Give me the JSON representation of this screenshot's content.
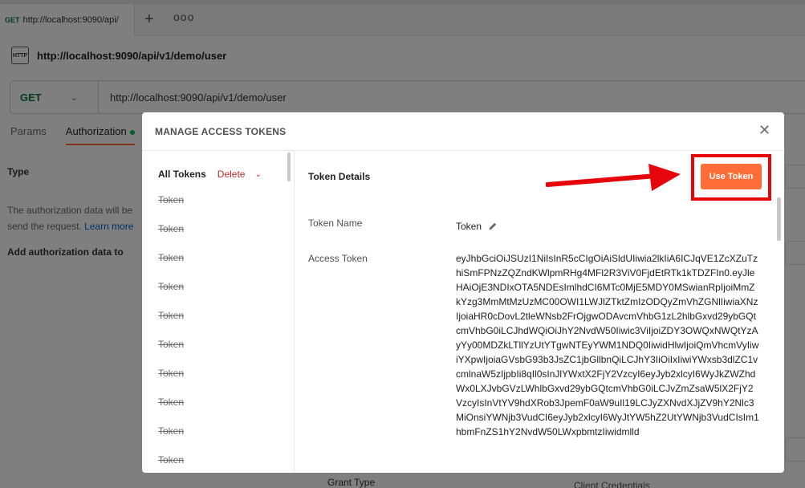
{
  "app": {
    "tab": {
      "method": "GET",
      "url": "http://localhost:9090/api/"
    },
    "request_title": "http://localhost:9090/api/v1/demo/user",
    "http_icon_text": "HTTP",
    "method": "GET",
    "url": "http://localhost:9090/api/v1/demo/user",
    "subtabs": {
      "params": "Params",
      "authorization": "Authorization"
    },
    "auth_panel": {
      "type_label": "Type",
      "description": "The authorization data will be",
      "description2": "send the request.",
      "learn_more": "Learn more",
      "add_to_label": "Add authorization data to"
    },
    "grant_type_label": "Grant Type",
    "grant_type_value": "Client Credentials"
  },
  "modal": {
    "title": "MANAGE ACCESS TOKENS",
    "sidebar": {
      "all_tokens": "All Tokens",
      "delete": "Delete",
      "tokens": [
        "Token",
        "Token",
        "Token",
        "Token",
        "Token",
        "Token",
        "Token",
        "Token",
        "Token",
        "Token"
      ]
    },
    "details": {
      "title": "Token Details",
      "use_token_label": "Use Token",
      "token_name_label": "Token Name",
      "token_name_value": "Token",
      "access_token_label": "Access Token",
      "access_token_value": "eyJhbGciOiJSUzI1NiIsInR5cCIgOiAiSldUIiwia2lkIiA6ICJqVE1ZcXZuTzhiSmFPNzZQZndKWlpmRHg4MFl2R3ViV0FjdEtRTk1kTDZFIn0.eyJleHAiOjE3NDIxOTA5NDEsImlhdCI6MTc0MjE5MDY0MSwianRpIjoiMmZkYzg3MmMtMzUzMC00OWI1LWJlZTktZmIzODQyZmVhZGNlIiwiaXNzIjoiaHR0cDovL2tleWNsb2FrOjgwODAvcmVhbG1zL2hlbGxvd29ybGQtcmVhbG0iLCJhdWQiOiJhY2NvdW50Iiwic3ViIjoiZDY3OWQxNWQtYzAyYy00MDZkLTllYzUtYTgwNTEyYWM1NDQ0IiwidHlwIjoiQmVhcmVyIiwiYXpwIjoiaGVsbG93b3JsZC1jbGllbnQiLCJhY3IiOiIxIiwiYWxsb3dlZC1vcmlnaW5zIjpbIi8qIl0sInJlYWxtX2FjY2VzcyI6eyJyb2xlcyI6WyJkZWZhdWx0LXJvbGVzLWhlbGxvd29ybGQtcmVhbG0iLCJvZmZsaW5lX2FjY2VzcyIsInVtYV9hdXRob3JpemF0aW9uIl19LCJyZXNvdXJjZV9hY2Nlc3MiOnsiYWNjb3VudCI6eyJyb2xlcyI6WyJtYW5hZ2UtYWNjb3VudCIsIm1hbmFnZS1hY2NvdW50LWxpbmtzIiwidmlld"
    }
  },
  "colors": {
    "accent": "#ff6c37",
    "highlight_frame": "#e5050a",
    "get_method": "#0b7a43",
    "delete": "#c02a2a"
  },
  "icons": [
    "http-icon",
    "plus-icon",
    "more-icon",
    "chevron-down-icon",
    "close-icon",
    "pencil-icon",
    "red-arrow-annotation"
  ]
}
